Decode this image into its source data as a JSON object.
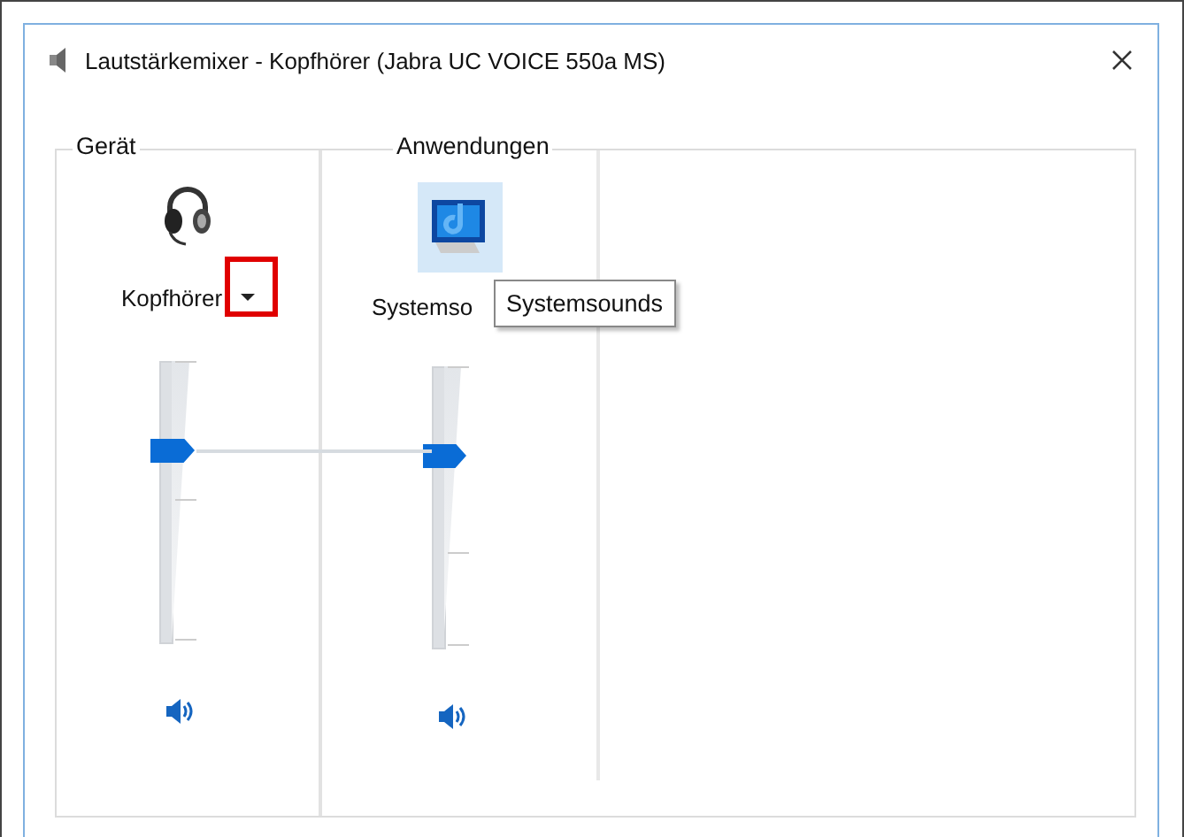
{
  "window": {
    "title": "Lautstärkemixer - Kopfhörer (Jabra UC VOICE 550a MS)"
  },
  "device": {
    "group_label": "Gerät",
    "name": "Kopfhörer",
    "level": 0.68,
    "muted": false,
    "highlighted": true
  },
  "applications": {
    "group_label": "Anwendungen",
    "items": [
      {
        "name": "Systemso",
        "level": 0.68,
        "muted": false,
        "hovered": true
      }
    ]
  },
  "tooltip": "Systemsounds"
}
